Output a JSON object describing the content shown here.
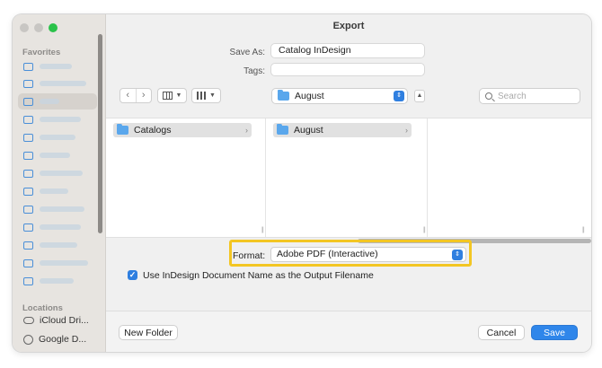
{
  "window": {
    "title": "Export"
  },
  "sidebar": {
    "favorites_heading": "Favorites",
    "favorites": [
      {
        "icon": "folder-icon",
        "selected": false
      },
      {
        "icon": "folder-icon",
        "selected": false
      },
      {
        "icon": "folder-icon",
        "selected": true
      },
      {
        "icon": "folder-icon",
        "selected": false
      },
      {
        "icon": "desktop-icon",
        "selected": false
      },
      {
        "icon": "film-icon",
        "selected": false
      },
      {
        "icon": "folder-icon",
        "selected": false
      },
      {
        "icon": "folder-icon",
        "selected": false
      },
      {
        "icon": "document-icon",
        "selected": false
      },
      {
        "icon": "download-icon",
        "selected": false
      },
      {
        "icon": "document-icon",
        "selected": false
      },
      {
        "icon": "drive-icon",
        "selected": false
      },
      {
        "icon": "folder-icon",
        "selected": false
      }
    ],
    "locations_heading": "Locations",
    "locations": [
      {
        "icon": "cloud-icon",
        "label": "iCloud Dri..."
      },
      {
        "icon": "drive-icon",
        "label": "Google D..."
      }
    ]
  },
  "save_as": {
    "label": "Save As:",
    "value": "Catalog InDesign"
  },
  "tags": {
    "label": "Tags:",
    "value": ""
  },
  "toolbar": {
    "back": "‹",
    "forward": "›",
    "location": "August",
    "search_placeholder": "Search"
  },
  "columns": [
    {
      "item": "Catalogs"
    },
    {
      "item": "August"
    },
    {
      "item": ""
    }
  ],
  "format": {
    "label": "Format:",
    "value": "Adobe PDF (Interactive)"
  },
  "option": {
    "label": "Use InDesign Document Name as the Output Filename",
    "checked": true
  },
  "buttons": {
    "new_folder": "New Folder",
    "cancel": "Cancel",
    "save": "Save"
  },
  "colors": {
    "accent": "#2f86ea",
    "highlight": "#f3c623"
  }
}
